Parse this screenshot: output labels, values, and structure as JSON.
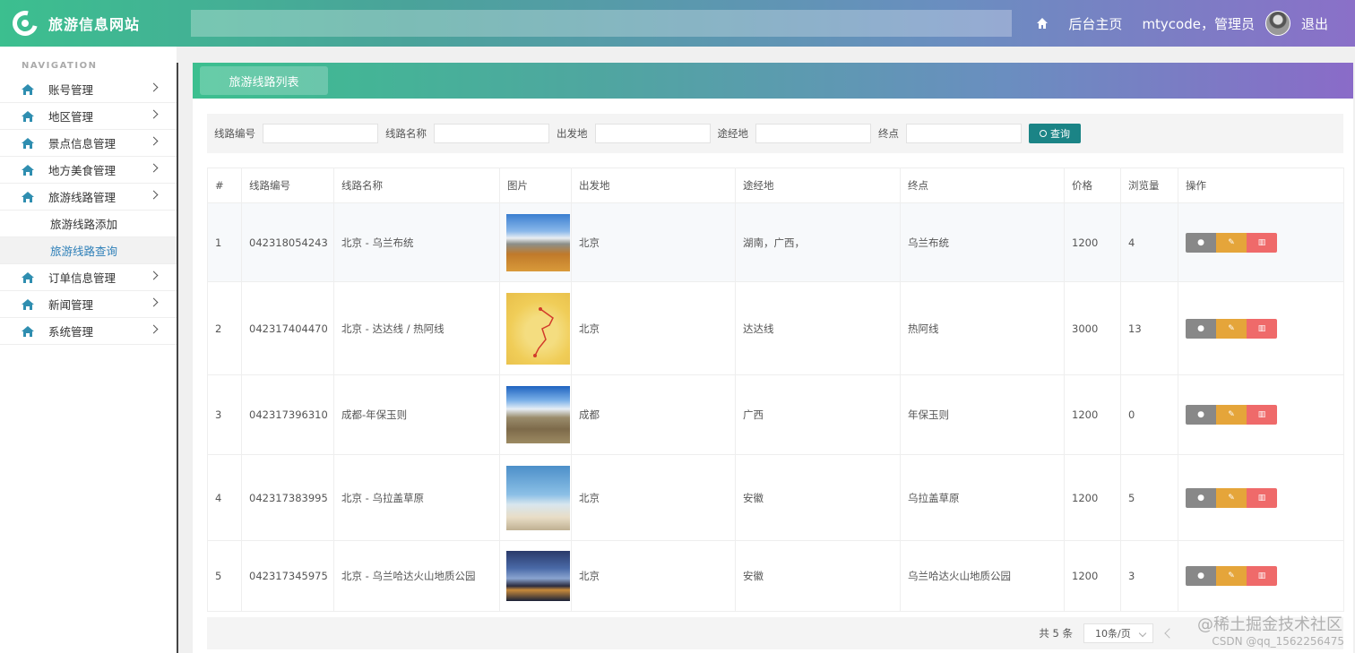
{
  "header": {
    "site_title": "旅游信息网站",
    "home_link": "后台主页",
    "admin_name": "mtycode，管理员",
    "logout": "退出"
  },
  "sidebar": {
    "nav_title": "NAVIGATION",
    "items": [
      {
        "label": "账号管理"
      },
      {
        "label": "地区管理"
      },
      {
        "label": "景点信息管理"
      },
      {
        "label": "地方美食管理"
      },
      {
        "label": "旅游线路管理"
      }
    ],
    "sub_items": [
      {
        "label": "旅游线路添加"
      },
      {
        "label": "旅游线路查询"
      }
    ],
    "items_after": [
      {
        "label": "订单信息管理"
      },
      {
        "label": "新闻管理"
      },
      {
        "label": "系统管理"
      }
    ]
  },
  "tab": {
    "label": "旅游线路列表"
  },
  "filter": {
    "route_no_label": "线路编号",
    "route_name_label": "线路名称",
    "departure_label": "出发地",
    "via_label": "途经地",
    "destination_label": "终点",
    "query_label": "查询"
  },
  "table": {
    "headers": [
      "#",
      "线路编号",
      "线路名称",
      "图片",
      "出发地",
      "途经地",
      "终点",
      "价格",
      "浏览量",
      "操作"
    ],
    "rows": [
      {
        "idx": "1",
        "code": "042318054243",
        "name": "北京 - 乌兰布统",
        "from": "北京",
        "via": "湖南，广西，",
        "to": "乌兰布统",
        "price": "1200",
        "views": "4"
      },
      {
        "idx": "2",
        "code": "042317404470",
        "name": "北京 - 达达线 / 热阿线",
        "from": "北京",
        "via": "达达线",
        "to": "热阿线",
        "price": "3000",
        "views": "13"
      },
      {
        "idx": "3",
        "code": "042317396310",
        "name": "成都-年保玉则",
        "from": "成都",
        "via": "广西",
        "to": "年保玉则",
        "price": "1200",
        "views": "0"
      },
      {
        "idx": "4",
        "code": "042317383995",
        "name": "北京 - 乌拉盖草原",
        "from": "北京",
        "via": "安徽",
        "to": "乌拉盖草原",
        "price": "1200",
        "views": "5"
      },
      {
        "idx": "5",
        "code": "042317345975",
        "name": "北京 - 乌兰哈达火山地质公园",
        "from": "北京",
        "via": "安徽",
        "to": "乌兰哈达火山地质公园",
        "price": "1200",
        "views": "3"
      }
    ]
  },
  "pager": {
    "total": "共 5 条",
    "page_size": "10条/页"
  },
  "watermark": "@稀土掘金技术社区",
  "watermark2": "CSDN @qq_1562256475",
  "colors": {
    "accent": "#3cbf8f",
    "query_btn": "#1b8486",
    "edit": "#e5a53a",
    "delete": "#ef6a6a",
    "view": "#888888"
  }
}
